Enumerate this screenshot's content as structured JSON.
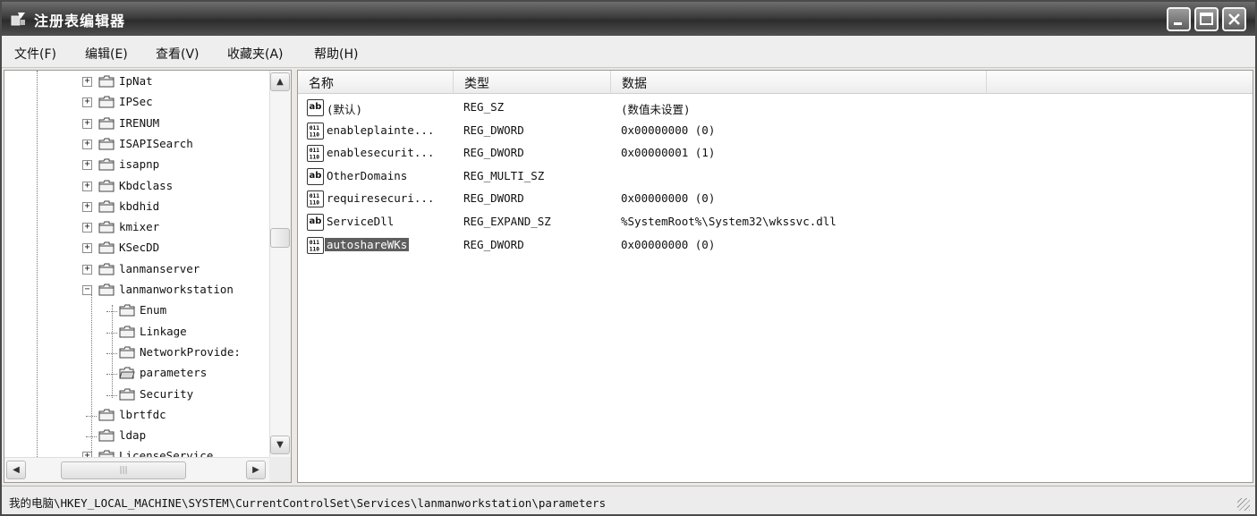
{
  "window": {
    "title": "注册表编辑器",
    "controls": {
      "minimize": "minimize-icon",
      "maximize": "maximize-icon",
      "close": "close-icon"
    }
  },
  "menu": [
    "文件(F)",
    "编辑(E)",
    "查看(V)",
    "收藏夹(A)",
    "帮助(H)"
  ],
  "tree": {
    "items": [
      {
        "label": "IpNat",
        "expander": "+"
      },
      {
        "label": "IPSec",
        "expander": "+"
      },
      {
        "label": "IRENUM",
        "expander": "+"
      },
      {
        "label": "ISAPISearch",
        "expander": "+"
      },
      {
        "label": "isapnp",
        "expander": "+"
      },
      {
        "label": "Kbdclass",
        "expander": "+"
      },
      {
        "label": "kbdhid",
        "expander": "+"
      },
      {
        "label": "kmixer",
        "expander": "+"
      },
      {
        "label": "KSecDD",
        "expander": "+"
      },
      {
        "label": "lanmanserver",
        "expander": "+"
      },
      {
        "label": "lanmanworkstation",
        "expander": "−"
      },
      {
        "label": "Enum",
        "expander": ""
      },
      {
        "label": "Linkage",
        "expander": ""
      },
      {
        "label": "NetworkProvide:",
        "expander": ""
      },
      {
        "label": "parameters",
        "expander": ""
      },
      {
        "label": "Security",
        "expander": ""
      },
      {
        "label": "lbrtfdc",
        "expander": ""
      },
      {
        "label": "ldap",
        "expander": ""
      },
      {
        "label": "LicenseService",
        "expander": "+"
      }
    ]
  },
  "values": {
    "columns": [
      "名称",
      "类型",
      "数据"
    ],
    "rows": [
      {
        "icon": "ab",
        "name": "(默认)",
        "type": "REG_SZ",
        "data": "(数值未设置)"
      },
      {
        "icon": "bin",
        "name": "enableplainte...",
        "type": "REG_DWORD",
        "data": "0x00000000 (0)"
      },
      {
        "icon": "bin",
        "name": "enablesecurit...",
        "type": "REG_DWORD",
        "data": "0x00000001 (1)"
      },
      {
        "icon": "ab",
        "name": "OtherDomains",
        "type": "REG_MULTI_SZ",
        "data": ""
      },
      {
        "icon": "bin",
        "name": "requiresecuri...",
        "type": "REG_DWORD",
        "data": "0x00000000 (0)"
      },
      {
        "icon": "ab",
        "name": "ServiceDll",
        "type": "REG_EXPAND_SZ",
        "data": "%SystemRoot%\\System32\\wkssvc.dll"
      },
      {
        "icon": "bin",
        "name": "autoshareWKs",
        "type": "REG_DWORD",
        "data": "0x00000000 (0)",
        "selected": true
      }
    ]
  },
  "status": {
    "path": "我的电脑\\HKEY_LOCAL_MACHINE\\SYSTEM\\CurrentControlSet\\Services\\lanmanworkstation\\parameters"
  },
  "colors": {
    "titlebar": "#3d3d3d",
    "selection": "#5e5e5e"
  }
}
